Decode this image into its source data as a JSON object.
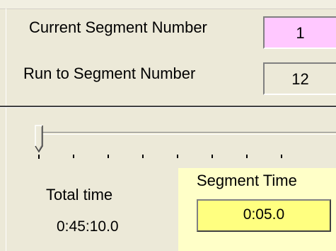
{
  "segment": {
    "current_label": "Current Segment Number",
    "current_value": "1",
    "run_to_label": "Run to Segment Number",
    "run_to_value": "12"
  },
  "slider": {
    "position": 0,
    "tick_count": 8
  },
  "total": {
    "label": "Total time",
    "value": "0:45:10.0"
  },
  "segment_time": {
    "label": "Segment Time",
    "value": "0:05.0"
  },
  "colors": {
    "dialog_bg": "#ece9d8",
    "current_box_bg": "#ffc8ff",
    "segment_panel_bg": "#ffffc8",
    "segment_box_bg": "#ffff80"
  }
}
